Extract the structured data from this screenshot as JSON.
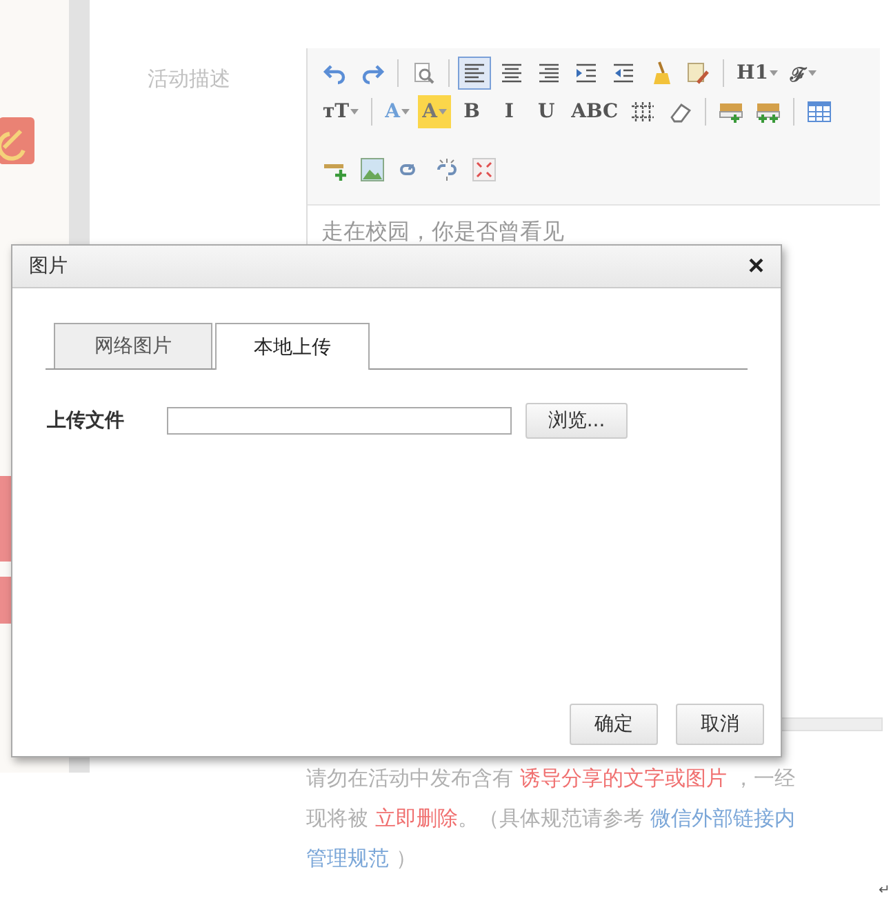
{
  "field_label": "活动描述",
  "toolbar": [
    {
      "kind": "undo",
      "selected": false
    },
    {
      "kind": "redo",
      "selected": false
    },
    {
      "kind": "sep"
    },
    {
      "kind": "preview",
      "selected": false
    },
    {
      "kind": "sep"
    },
    {
      "kind": "align-left",
      "selected": true
    },
    {
      "kind": "align-center",
      "selected": false
    },
    {
      "kind": "align-right",
      "selected": false
    },
    {
      "kind": "indent",
      "selected": false
    },
    {
      "kind": "outdent",
      "selected": false
    },
    {
      "kind": "brush",
      "selected": false
    },
    {
      "kind": "paste",
      "selected": false
    },
    {
      "kind": "sep"
    },
    {
      "kind": "text",
      "label": "H1",
      "dropdown": true,
      "selected": false
    },
    {
      "kind": "text",
      "label": "ℱ",
      "dropdown": true,
      "selected": false
    },
    {
      "kind": "text",
      "label": "тT",
      "dropdown": true,
      "selected": false
    },
    {
      "kind": "sep"
    },
    {
      "kind": "text",
      "label": "A",
      "dropdown": true,
      "selected": false,
      "color": "#6fa0d8"
    },
    {
      "kind": "highlight",
      "label": "A",
      "dropdown": true,
      "selected": false
    },
    {
      "kind": "text",
      "label": "B",
      "selected": false
    },
    {
      "kind": "text",
      "label": "I",
      "selected": false
    },
    {
      "kind": "text",
      "label": "U",
      "selected": false
    },
    {
      "kind": "text",
      "label": "ABC",
      "selected": false
    },
    {
      "kind": "spacing",
      "selected": false
    },
    {
      "kind": "eraser",
      "selected": false
    },
    {
      "kind": "sep"
    },
    {
      "kind": "row-above",
      "selected": false
    },
    {
      "kind": "row-below",
      "selected": false
    },
    {
      "kind": "sep"
    },
    {
      "kind": "table",
      "selected": false
    },
    {
      "kind": "hr",
      "selected": false
    },
    {
      "kind": "image",
      "selected": false
    },
    {
      "kind": "link",
      "selected": false
    },
    {
      "kind": "unlink",
      "selected": false
    },
    {
      "kind": "fullscreen",
      "selected": false
    }
  ],
  "editor_text": "走在校园，你是否曾看见",
  "dialog": {
    "title": "图片",
    "close": "×",
    "tabs": [
      {
        "label": "网络图片",
        "selected": false
      },
      {
        "label": "本地上传",
        "selected": true
      }
    ],
    "upload_label": "上传文件",
    "browse": "浏览...",
    "buttons": [
      "确定",
      "取消"
    ]
  },
  "notice": [
    [
      {
        "text": "请勿在活动中发布含有 ",
        "kind": "plain"
      },
      {
        "text": "诱导分享的文字或图片",
        "kind": "warn"
      },
      {
        "text": " ，一经",
        "kind": "plain"
      }
    ],
    [
      {
        "text": "现将被 ",
        "kind": "plain"
      },
      {
        "text": "立即删除",
        "kind": "warn"
      },
      {
        "text": "。（具体规范请参考 ",
        "kind": "plain"
      },
      {
        "text": "微信外部链接内",
        "kind": "link"
      }
    ],
    [
      {
        "text": "管理规范",
        "kind": "link"
      },
      {
        "text": " ）",
        "kind": "plain"
      }
    ]
  ],
  "return_mark": "↵"
}
